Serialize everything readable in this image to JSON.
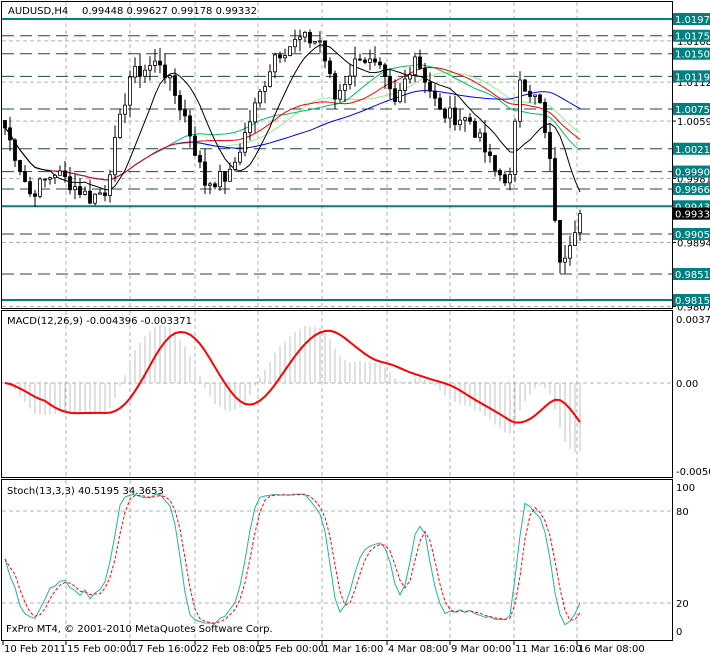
{
  "header": {
    "symbol": "AUDUSD,H4",
    "ohlc": "0.99448 0.99627 0.99178 0.99332"
  },
  "footer": {
    "copyright": "FxPro MT4, © 2001-2010 MetaQuotes Software Corp."
  },
  "colors": {
    "bull": "#000000",
    "bear": "#000000",
    "level": "#008080",
    "ma_fast": "#000000",
    "ma_mid": "#ff0000",
    "ma_slow": "#0000ff",
    "ma_green": "#00c060",
    "ma_light": "#90ee90",
    "macd_hist": "#c0c0c0",
    "macd_signal": "#ff0000",
    "stoch_main": "#20b2aa",
    "stoch_signal": "#ff0000"
  },
  "chart_data": [
    {
      "type": "candlestick",
      "title": "AUDUSD,H4",
      "ylim": [
        0.9803,
        1.021
      ],
      "price_levels": [
        "1.01977",
        "1.01750",
        "1.01505",
        "1.01198",
        "1.00755",
        "1.00214",
        "0.99904",
        "0.99668",
        "0.99432",
        "0.99056",
        "0.98512",
        "0.98159"
      ],
      "hidden_ticks": [
        "1.01680",
        "1.01120",
        "1.00590",
        "0.99810",
        "0.98940",
        "0.98070"
      ],
      "current_price": "0.99332",
      "solid_levels": [
        "1.01977",
        "0.99432",
        "0.98159"
      ],
      "close_anchors": [
        [
          0,
          1.005
        ],
        [
          5,
          0.996
        ],
        [
          10,
          0.999
        ],
        [
          17,
          0.9955
        ],
        [
          20,
          0.9965
        ],
        [
          25,
          1.012
        ],
        [
          31,
          1.014
        ],
        [
          36,
          1.0065
        ],
        [
          40,
          0.9975
        ],
        [
          45,
          0.9985
        ],
        [
          49,
          1.006
        ],
        [
          54,
          1.015
        ],
        [
          59,
          1.017
        ],
        [
          63,
          1.0168
        ],
        [
          66,
          1.009
        ],
        [
          71,
          1.015
        ],
        [
          75,
          1.0125
        ],
        [
          78,
          1.008
        ],
        [
          82,
          1.015
        ],
        [
          87,
          1.007
        ],
        [
          93,
          1.006
        ],
        [
          98,
          0.999
        ],
        [
          101,
          0.998
        ],
        [
          103,
          1.012
        ],
        [
          107,
          1.008
        ],
        [
          109,
          1.0
        ],
        [
          111,
          0.986
        ],
        [
          113,
          0.99
        ],
        [
          115,
          0.99332
        ]
      ]
    },
    {
      "type": "line",
      "title": "MACD(12,26,9) -0.004396 -0.003371",
      "ylim": [
        -0.00508,
        0.0037
      ],
      "ticks": [
        "0.00370",
        "0.00",
        "-0.00508"
      ]
    },
    {
      "type": "line",
      "title": "Stoch(13,3,3) 40.5195 34.3653",
      "ylim": [
        0,
        100
      ],
      "ticks": [
        "100",
        "80",
        "20",
        "0"
      ]
    }
  ],
  "time_axis": [
    "10 Feb 2011",
    "15 Feb 00:00",
    "17 Feb 16:00",
    "22 Feb 08:00",
    "25 Feb 00:00",
    "1 Mar 16:00",
    "4 Mar 08:00",
    "9 Mar 00:00",
    "11 Mar 16:00",
    "16 Mar 08:00"
  ]
}
